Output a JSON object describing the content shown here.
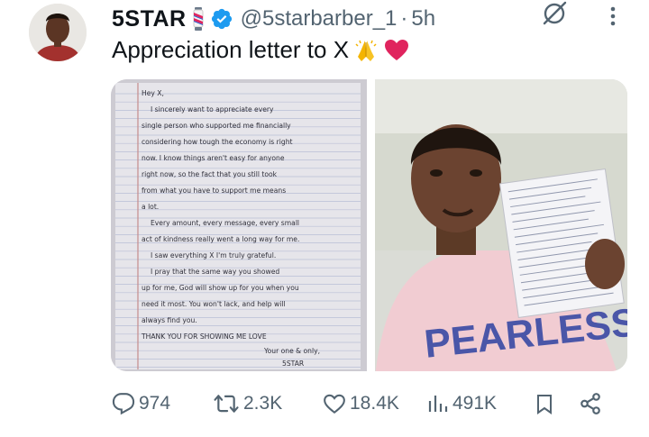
{
  "author": {
    "display_name": "5STAR",
    "handle": "@5starbarber_1",
    "separator": "·",
    "timestamp": "5h"
  },
  "post": {
    "text": "Appreciation letter to X",
    "emojis": [
      "folded-hands",
      "red-heart"
    ]
  },
  "media": {
    "letter": {
      "lines": [
        "Hey X,",
        "I sincerely want to appreciate every",
        "single person who supported me financially",
        "considering how tough the economy is right",
        "now. I know things aren't easy for anyone",
        "right now, so the fact that you still took",
        "from what you have to support me means",
        "a lot.",
        "Every amount, every message, every small",
        "act of kindness really went a long way for me.",
        "I saw everything X I'm truly grateful.",
        "I pray that the same way you showed",
        "up for me, God will show up for you when you",
        "need it most. You won't lack, and help will",
        "always find you.",
        "THANK YOU FOR SHOWING ME LOVE",
        "Your one & only,",
        "5STAR"
      ]
    },
    "shirt_text": "PEARLESS"
  },
  "actions": {
    "replies": "974",
    "reposts": "2.3K",
    "likes": "18.4K",
    "views": "491K"
  },
  "colors": {
    "text": "#0f1419",
    "secondary": "#536471",
    "verified": "#1d9bf0",
    "heart": "#e0245e"
  }
}
